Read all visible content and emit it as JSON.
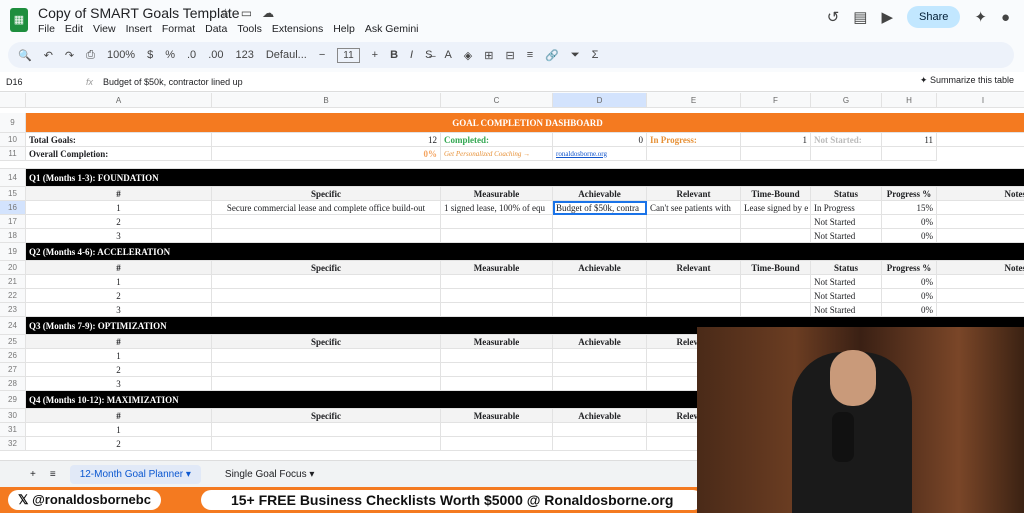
{
  "app": {
    "title": "Copy of SMART Goals Template",
    "menus": [
      "File",
      "Edit",
      "View",
      "Insert",
      "Format",
      "Data",
      "Tools",
      "Extensions",
      "Help",
      "Ask Gemini"
    ],
    "share": "Share"
  },
  "toolbar": {
    "zoom": "100%",
    "currency": "$",
    "percent": "%",
    "dec_dec": ".0",
    "dec_inc": ".00",
    "format": "123",
    "font": "Defaul...",
    "font_size": "11",
    "bold": "B",
    "italic": "I"
  },
  "formula": {
    "cell_ref": "D16",
    "fx": "fx",
    "value": "Budget of $50k, contractor lined up",
    "summarize": "Summarize this table"
  },
  "columns": [
    "A",
    "B",
    "C",
    "D",
    "E",
    "F",
    "G",
    "H",
    "I"
  ],
  "dashboard": {
    "title": "GOAL COMPLETION DASHBOARD",
    "total_label": "Total Goals:",
    "total": "12",
    "completed_label": "Completed:",
    "completed": "0",
    "inprog_label": "In Progress:",
    "inprog": "1",
    "notstarted_label": "Not Started:",
    "notstarted": "11",
    "overall_label": "Overall Completion:",
    "overall": "0%",
    "coaching": "Get Personalized Coaching →",
    "link": "ronaldosborne.org"
  },
  "headers": [
    "#",
    "Specific",
    "Measurable",
    "Achievable",
    "Relevant",
    "Time-Bound",
    "Status",
    "Progress %",
    "Notes"
  ],
  "sections": [
    {
      "title": "Q1 (Months 1-3): FOUNDATION",
      "rows": [
        [
          "1",
          "Secure commercial lease and complete office build-out",
          "1 signed lease, 100% of equ",
          "Budget of $50k, contra",
          "Can't see patients with",
          "Lease signed by e",
          "In Progress",
          "15%"
        ],
        [
          "2",
          "",
          "",
          "",
          "",
          "",
          "Not Started",
          "0%"
        ],
        [
          "3",
          "",
          "",
          "",
          "",
          "",
          "Not Started",
          "0%"
        ]
      ]
    },
    {
      "title": "Q2 (Months 4-6): ACCELERATION",
      "rows": [
        [
          "1",
          "",
          "",
          "",
          "",
          "",
          "Not Started",
          "0%"
        ],
        [
          "2",
          "",
          "",
          "",
          "",
          "",
          "Not Started",
          "0%"
        ],
        [
          "3",
          "",
          "",
          "",
          "",
          "",
          "Not Started",
          "0%"
        ]
      ]
    },
    {
      "title": "Q3 (Months 7-9): OPTIMIZATION",
      "rows": [
        [
          "1",
          "",
          "",
          "",
          "",
          "",
          "",
          ""
        ],
        [
          "2",
          "",
          "",
          "",
          "",
          "",
          "",
          ""
        ],
        [
          "3",
          "",
          "",
          "",
          "",
          "",
          "",
          ""
        ]
      ]
    },
    {
      "title": "Q4 (Months 10-12): MAXIMIZATION",
      "rows": [
        [
          "1",
          "",
          "",
          "",
          "",
          "",
          "",
          ""
        ],
        [
          "2",
          "",
          "",
          "",
          "",
          "",
          "",
          ""
        ]
      ]
    }
  ],
  "row_numbers": {
    "dash": [
      "9",
      "10",
      "11"
    ],
    "sections": [
      [
        "14",
        "15",
        "16",
        "17",
        "18"
      ],
      [
        "19",
        "20",
        "21",
        "22",
        "23"
      ],
      [
        "24",
        "25",
        "26",
        "27",
        "28"
      ],
      [
        "29",
        "30",
        "31",
        "32"
      ]
    ]
  },
  "tabs": [
    "12-Month Goal Planner",
    "Single Goal Focus"
  ],
  "banner": {
    "handle": "@ronaldosbornebc",
    "offer": "15+ FREE Business Checklists Worth $5000 @ Ronaldosborne.org"
  },
  "colors": {
    "orange": "#f47a20",
    "green": "#34a853",
    "black": "#000000"
  }
}
